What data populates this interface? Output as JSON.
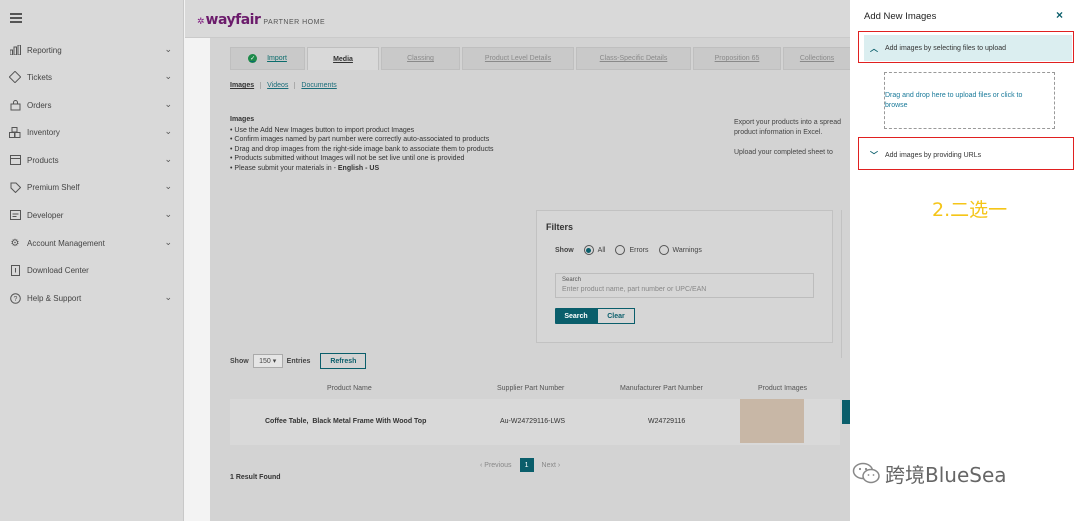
{
  "header": {
    "logo_word": "wayfair",
    "logo_sub": "PARTNER HOME"
  },
  "sidebar": {
    "items": [
      {
        "label": "Reporting",
        "icon": "bar-chart-icon",
        "chevron": true
      },
      {
        "label": "Tickets",
        "icon": "ticket-icon",
        "chevron": true
      },
      {
        "label": "Orders",
        "icon": "bag-icon",
        "chevron": true
      },
      {
        "label": "Inventory",
        "icon": "boxes-icon",
        "chevron": true
      },
      {
        "label": "Products",
        "icon": "product-icon",
        "chevron": true
      },
      {
        "label": "Premium Shelf",
        "icon": "tag-icon",
        "chevron": true
      },
      {
        "label": "Developer",
        "icon": "developer-icon",
        "chevron": true
      },
      {
        "label": "Account Management",
        "icon": "gear-icon",
        "chevron": true
      },
      {
        "label": "Download Center",
        "icon": "document-icon",
        "chevron": false
      },
      {
        "label": "Help & Support",
        "icon": "help-icon",
        "chevron": true
      }
    ]
  },
  "tabs": [
    "Import",
    "Media",
    "Classing",
    "Product Level Details",
    "Class-Specific Details",
    "Proposition 65",
    "Collections"
  ],
  "subtabs": [
    "Images",
    "Videos",
    "Documents"
  ],
  "instructions": {
    "title": "Images",
    "bullets": [
      "Use the Add New Images button to import product Images",
      "Confirm images named by part number were correctly auto-associated to products",
      "Drag and drop images from the right-side image bank to associate them to products",
      "Products submitted without Images will not be set live until one is provided"
    ],
    "last_bullet_prefix": "Please submit your materials in - ",
    "last_bullet_bold": "English - US"
  },
  "export_text": {
    "line1": "Export your products into a spread",
    "line2": "product information in Excel.",
    "line3": "Upload your completed sheet to"
  },
  "filters": {
    "title": "Filters",
    "show_label": "Show",
    "options": [
      "All",
      "Errors",
      "Warnings"
    ],
    "selected": "All",
    "search_label": "Search",
    "search_placeholder": "Enter product name, part number or UPC/EAN",
    "search_button": "Search",
    "clear_button": "Clear"
  },
  "entries": {
    "show_label": "Show",
    "count": "150",
    "entries_label": "Entries",
    "refresh_button": "Refresh"
  },
  "table": {
    "headers": [
      "Product Name",
      "Supplier Part Number",
      "Manufacturer Part Number",
      "Product Images"
    ],
    "row": {
      "name_part1": "Coffee Table,",
      "name_part2": "Black Metal Frame With Wood Top",
      "supplier_part": "Au-W24729116-LWS",
      "manufacturer_part": "W24729116"
    }
  },
  "pagination": {
    "prev": "‹ Previous",
    "current": "1",
    "next": "Next ›"
  },
  "result_text": "1 Result Found",
  "panel": {
    "title": "Add New Images",
    "close": "×",
    "option1": "Add images by selecting files to upload",
    "dropzone_line1": "Drag and drop here to upload files or click to",
    "dropzone_line2": "browse",
    "option2": "Add images by providing URLs",
    "annotation": "2.二选一",
    "watermark": "跨境BlueSea"
  },
  "colors": {
    "accent": "#0a5e6b",
    "logo": "#6b1b6b",
    "highlight_red": "#e02020",
    "annotation_yellow": "#f5c518"
  }
}
